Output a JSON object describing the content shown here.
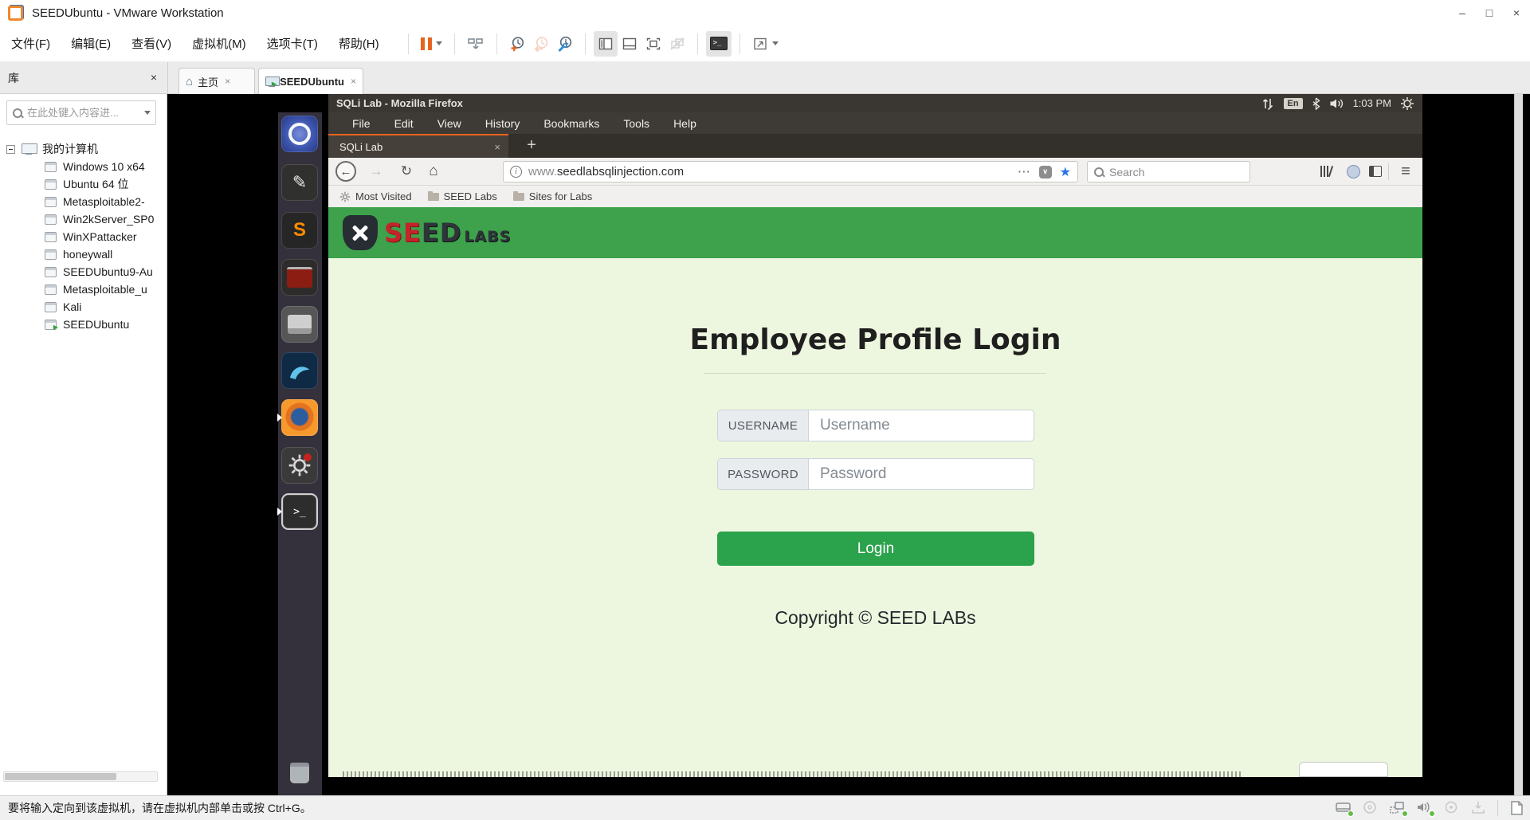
{
  "colors": {
    "accent_orange": "#e8641e",
    "banner_green": "#3da24b",
    "button_green": "#2ba24c",
    "page_background": "#edf6df",
    "bookmark_star_blue": "#2b74e2",
    "ubuntu_panel_dark": "#3a3632"
  },
  "vmware": {
    "title": "SEEDUbuntu - VMware Workstation",
    "window_buttons": {
      "minimize": "–",
      "maximize": "□",
      "close": "×"
    },
    "menu": {
      "file": "文件(F)",
      "edit": "编辑(E)",
      "view": "查看(V)",
      "vm": "虚拟机(M)",
      "tabs": "选项卡(T)",
      "help": "帮助(H)"
    },
    "tab_home": "主页",
    "tab_vm": "SEEDUbuntu",
    "tab_close": "×",
    "library": {
      "title": "库",
      "close": "×",
      "search_placeholder": "在此处键入内容进...",
      "root": "我的计算机",
      "vms": [
        "Windows 10 x64",
        "Ubuntu 64 位",
        "Metasploitable2-",
        "Win2kServer_SP0",
        "WinXPattacker",
        "honeywall",
        "SEEDUbuntu9-Au",
        "Metasploitable_u",
        "Kali",
        "SEEDUbuntu"
      ]
    },
    "status_text": "要将输入定向到该虚拟机，请在虚拟机内部单击或按 Ctrl+G。"
  },
  "ubuntu": {
    "window_title": "SQLi Lab - Mozilla Firefox",
    "keyboard_indicator": "En",
    "clock": "1:03 PM"
  },
  "firefox": {
    "menu": {
      "file": "File",
      "edit": "Edit",
      "view": "View",
      "history": "History",
      "bookmarks": "Bookmarks",
      "tools": "Tools",
      "help": "Help"
    },
    "tab_title": "SQLi Lab",
    "tab_close": "×",
    "new_tab": "+",
    "url_www": "www.",
    "url_host": "seedlabsqlinjection.com",
    "page_actions": "···",
    "search_placeholder": "Search",
    "bookmarks": [
      "Most Visited",
      "SEED Labs",
      "Sites for Labs"
    ]
  },
  "page": {
    "heading": "Employee Profile Login",
    "username_label": "USERNAME",
    "username_placeholder": "Username",
    "password_label": "PASSWORD",
    "password_placeholder": "Password",
    "login_label": "Login",
    "copyright": "Copyright © SEED LABs",
    "logo": {
      "se": "SE",
      "ed": "ED",
      "labs": "LABS"
    }
  },
  "icons": {
    "hamburger": "≡",
    "back_arrow": "←",
    "forward_arrow": "→",
    "reload": "↻",
    "home": "⌂",
    "star": "★",
    "play": "▶",
    "pencil": "✎",
    "terminal_prompt": ">_"
  }
}
